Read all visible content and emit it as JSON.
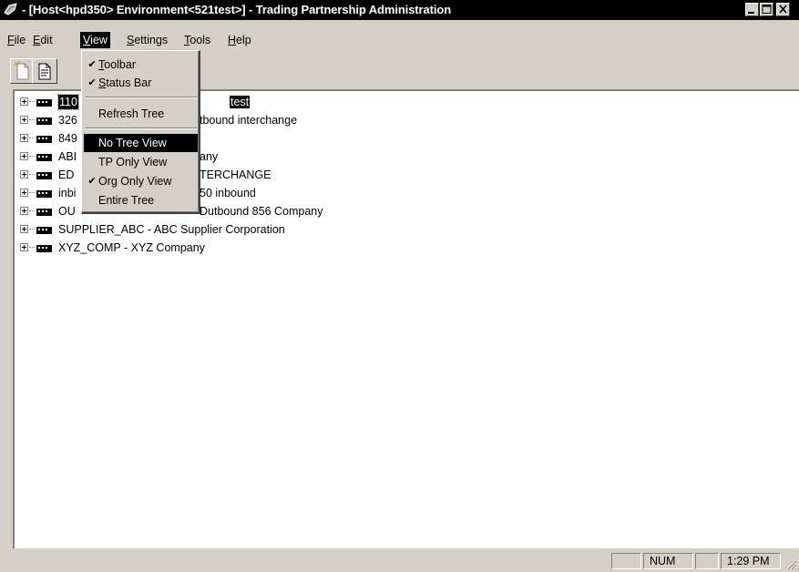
{
  "window": {
    "title": "- [Host<hpd350> Environment<521test>] - Trading Partnership Administration"
  },
  "menubar": {
    "items": [
      {
        "label": "File",
        "mnemonic": "F",
        "rest": "ile"
      },
      {
        "label": "Edit",
        "mnemonic": "E",
        "rest": "dit"
      },
      {
        "label": "View",
        "mnemonic": "V",
        "rest": "iew"
      },
      {
        "label": "Settings",
        "mnemonic": "S",
        "rest": "ettings"
      },
      {
        "label": "Tools",
        "mnemonic": "T",
        "rest": "ools"
      },
      {
        "label": "Help",
        "mnemonic": "H",
        "rest": "elp"
      }
    ]
  },
  "toolbar": {
    "buttons": [
      {
        "icon": "new-document-icon"
      },
      {
        "icon": "properties-icon"
      }
    ]
  },
  "view_menu": {
    "items": [
      {
        "mnemonic": "T",
        "rest": "oolbar",
        "checked": true
      },
      {
        "mnemonic": "S",
        "rest": "tatus Bar",
        "checked": true
      },
      {
        "label": "Refresh Tree",
        "checked": false
      },
      {
        "label": "No Tree View",
        "checked": false,
        "highlighted": true
      },
      {
        "label": "TP Only View",
        "checked": false
      },
      {
        "label": "Org Only View",
        "checked": true
      },
      {
        "label": "Entire Tree",
        "checked": false
      }
    ],
    "check_glyph": "✔"
  },
  "tree": {
    "rows": [
      {
        "label_left": "110",
        "label_right": "test",
        "selected": true
      },
      {
        "label_left": "326",
        "label_right": "tbound interchange"
      },
      {
        "label_left": "849",
        "label_right": ""
      },
      {
        "label_left": "ABI",
        "label_right": "any"
      },
      {
        "label_left": "ED",
        "label_right": "TERCHANGE"
      },
      {
        "label_left": "inbi",
        "label_right": "50 inbound"
      },
      {
        "label_left": "OU",
        "label_right": "Dutbound 856 Company"
      },
      {
        "label": "SUPPLIER_ABC  -  ABC Supplier Corporation"
      },
      {
        "label": "XYZ_COMP  -  XYZ Company"
      }
    ]
  },
  "statusbar": {
    "num": "NUM",
    "time": "1:29 PM"
  }
}
